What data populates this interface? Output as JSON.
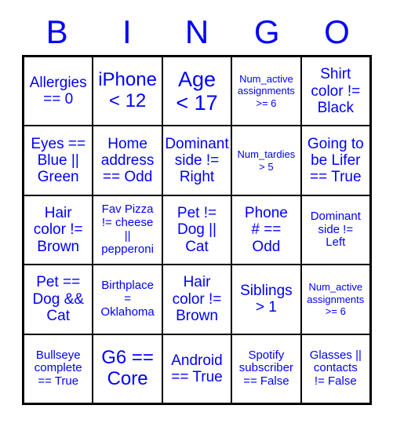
{
  "title": "BINGO card",
  "colors": {
    "text": "#0000ff",
    "border": "#000000",
    "background": "#ffffff"
  },
  "header": {
    "letters": [
      "B",
      "I",
      "N",
      "G",
      "O"
    ]
  },
  "grid": {
    "columns": 5,
    "rows": 5,
    "cells": [
      {
        "text": "Allergies\n== 0",
        "size": "md"
      },
      {
        "text": "iPhone\n< 12",
        "size": "lg"
      },
      {
        "text": "Age\n< 17",
        "size": "xl"
      },
      {
        "text": "Num_active\nassignments\n>= 6",
        "size": "xs"
      },
      {
        "text": "Shirt\ncolor !=\nBlack",
        "size": "md"
      },
      {
        "text": "Eyes ==\nBlue ||\nGreen",
        "size": "md"
      },
      {
        "text": "Home\naddress\n== Odd",
        "size": "md"
      },
      {
        "text": "Dominant\nside !=\nRight",
        "size": "md"
      },
      {
        "text": "Num_tardies\n> 5",
        "size": "xs"
      },
      {
        "text": "Going to\nbe Lifer\n== True",
        "size": "md"
      },
      {
        "text": "Hair\ncolor !=\nBrown",
        "size": "md"
      },
      {
        "text": "Fav Pizza\n!= cheese\n||\npepperoni",
        "size": "sm"
      },
      {
        "text": "Pet !=\nDog ||\nCat",
        "size": "md"
      },
      {
        "text": "Phone\n# ==\nOdd",
        "size": "md"
      },
      {
        "text": "Dominant\nside !=\nLeft",
        "size": "sm"
      },
      {
        "text": "Pet ==\nDog &&\nCat",
        "size": "md"
      },
      {
        "text": "Birthplace\n=\nOklahoma",
        "size": "sm"
      },
      {
        "text": "Hair\ncolor !=\nBrown",
        "size": "md"
      },
      {
        "text": "Siblings\n> 1",
        "size": "md"
      },
      {
        "text": "Num_active\nassignments\n>= 6",
        "size": "xs"
      },
      {
        "text": "Bullseye\ncomplete\n== True",
        "size": "sm"
      },
      {
        "text": "G6 ==\nCore",
        "size": "lg"
      },
      {
        "text": "Android\n== True",
        "size": "md"
      },
      {
        "text": "Spotify\nsubscriber\n== False",
        "size": "sm"
      },
      {
        "text": "Glasses ||\ncontacts\n!= False",
        "size": "sm"
      }
    ]
  }
}
